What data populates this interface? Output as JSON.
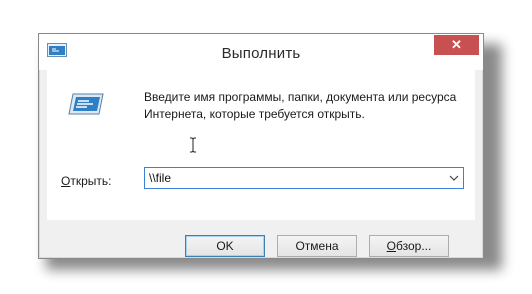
{
  "window": {
    "title": "Выполнить",
    "close_glyph": "✕"
  },
  "content": {
    "description": "Введите имя программы, папки, документа или ресурса Интернета, которые требуется открыть.",
    "open_label_prefix": "",
    "open_label_underlined": "О",
    "open_label_rest": "ткрыть:",
    "input_value": "\\\\file"
  },
  "buttons": {
    "ok": "OK",
    "cancel": "Отмена",
    "browse_underlined": "О",
    "browse_rest": "бзор..."
  },
  "icons": {
    "app": "run-app-icon",
    "run": "run-dialog-icon",
    "dropdown": "chevron-down-icon",
    "cursor": "text-cursor-icon"
  },
  "colors": {
    "close_button": "#c75050",
    "focus_border": "#3b82d6",
    "accent_icon": "#2f7fc6"
  }
}
